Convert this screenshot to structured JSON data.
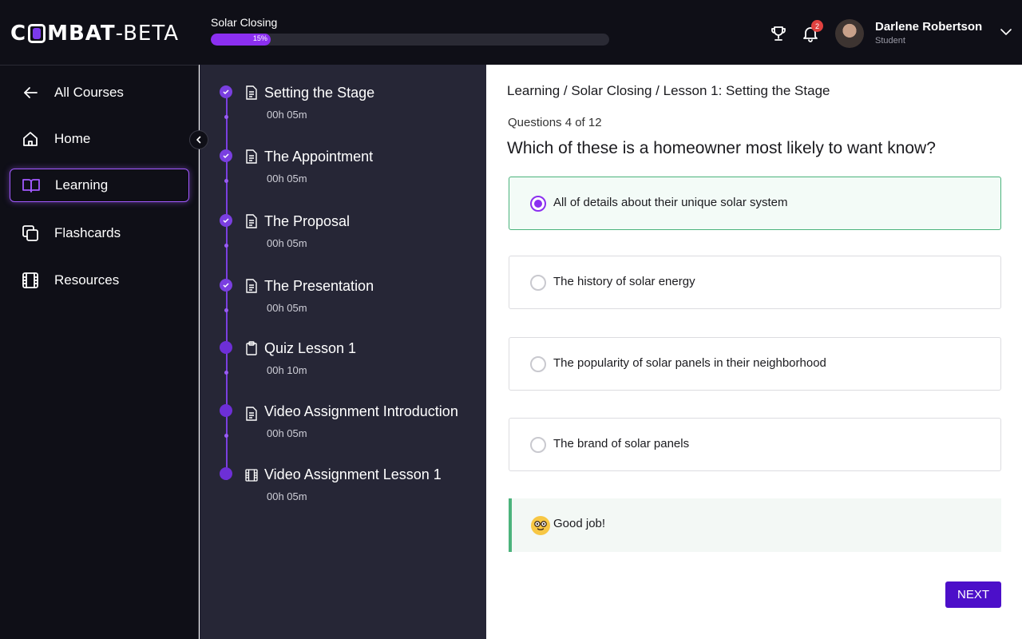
{
  "header": {
    "logo": {
      "pre": "C",
      "post": "MBAT",
      "suffix": "-BETA"
    },
    "course_title": "Solar Closing",
    "progress": {
      "percent": 15,
      "label": "15%"
    },
    "notifications_count": "2",
    "user": {
      "name": "Darlene Robertson",
      "role": "Student"
    },
    "accent_color": "#8b2ff0"
  },
  "sidebar": {
    "items": [
      {
        "label": "All Courses",
        "icon": "arrow-left-icon"
      },
      {
        "label": "Home",
        "icon": "home-icon"
      },
      {
        "label": "Learning",
        "icon": "book-open-icon",
        "active": true
      },
      {
        "label": "Flashcards",
        "icon": "flashcards-icon"
      },
      {
        "label": "Resources",
        "icon": "film-icon"
      }
    ]
  },
  "lessons": [
    {
      "title": "Setting the Stage",
      "duration": "00h 05m",
      "icon": "document-icon",
      "completed": true
    },
    {
      "title": "The Appointment",
      "duration": "00h 05m",
      "icon": "document-icon",
      "completed": true
    },
    {
      "title": "The Proposal",
      "duration": "00h 05m",
      "icon": "document-icon",
      "completed": true
    },
    {
      "title": "The Presentation",
      "duration": "00h 05m",
      "icon": "document-icon",
      "completed": true
    },
    {
      "title": "Quiz Lesson 1",
      "duration": "00h 10m",
      "icon": "clipboard-icon",
      "completed": false
    },
    {
      "title": "Video Assignment Introduction",
      "duration": "00h 05m",
      "icon": "document-icon",
      "completed": false
    },
    {
      "title": "Video Assignment Lesson 1",
      "duration": "00h 05m",
      "icon": "film-icon",
      "completed": false
    }
  ],
  "main": {
    "breadcrumb": "Learning / Solar Closing / Lesson 1: Setting the Stage",
    "question_count": "Questions 4 of 12",
    "question": "Which of these is a homeowner most likely to want know?",
    "options": [
      {
        "text": "All of details about their unique solar system",
        "selected": true
      },
      {
        "text": "The history of solar energy",
        "selected": false
      },
      {
        "text": "The popularity of solar panels in their neighborhood",
        "selected": false
      },
      {
        "text": "The brand of solar panels",
        "selected": false
      }
    ],
    "feedback": "Good job!",
    "next_label": "NEXT"
  }
}
